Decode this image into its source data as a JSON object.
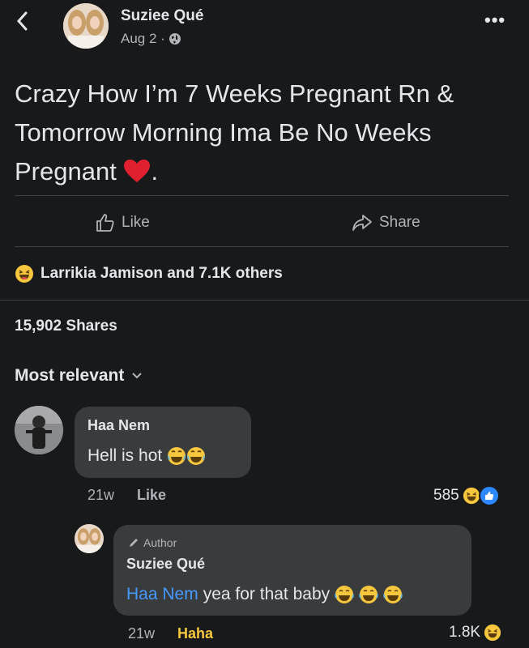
{
  "post": {
    "author": "Suziee Qué",
    "date": "Aug 2 ·",
    "text": "Crazy How I’m 7 Weeks Pregnant Rn & Tomorrow Morning Ima Be No Weeks Pregnant",
    "text_end": "."
  },
  "actions": {
    "like": "Like",
    "share": "Share"
  },
  "reactions": {
    "summary": "Larrikia Jamison and 7.1K others"
  },
  "shares": "15,902 Shares",
  "sort": {
    "label": "Most relevant"
  },
  "comments": [
    {
      "name": "Haa Nem",
      "text": "Hell is hot",
      "time": "21w",
      "action": "Like",
      "count": "585"
    },
    {
      "badge": "Author",
      "name": "Suziee Qué",
      "mention": "Haa Nem",
      "text": "yea for that baby",
      "time": "21w",
      "action": "Haha",
      "count": "1.8K"
    }
  ],
  "colors": {
    "background": "#18191a",
    "bubble": "#3a3b3c",
    "accent": "#4599ff",
    "haha": "#f7c73e"
  },
  "icons": [
    "back-icon",
    "globe-icon",
    "more-icon",
    "like-thumb-icon",
    "share-arrow-icon",
    "haha-emoji-icon",
    "crying-laughing-emoji-icon",
    "red-heart-icon",
    "chevron-down-icon",
    "pencil-icon"
  ]
}
